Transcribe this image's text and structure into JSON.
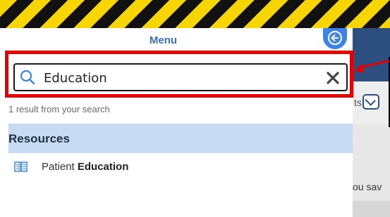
{
  "menu": {
    "title": "Menu",
    "back_icon": "arrow-left-icon"
  },
  "search": {
    "value": "Education",
    "placeholder": "",
    "search_icon": "magnifier-icon",
    "clear_icon": "close-x-icon"
  },
  "results": {
    "count_text": "1 result from your search",
    "sections": [
      {
        "header": "Resources",
        "items": [
          {
            "prefix": "Patient ",
            "match": "Education",
            "icon": "book-open-icon"
          }
        ]
      }
    ]
  },
  "background": {
    "partial_text_1": "ts",
    "partial_text_2": "ou sav"
  },
  "colors": {
    "accent": "#3d84e6",
    "highlight": "#e60000",
    "section_bg": "#c7dcf4",
    "nav_dark": "#2c4f80"
  }
}
